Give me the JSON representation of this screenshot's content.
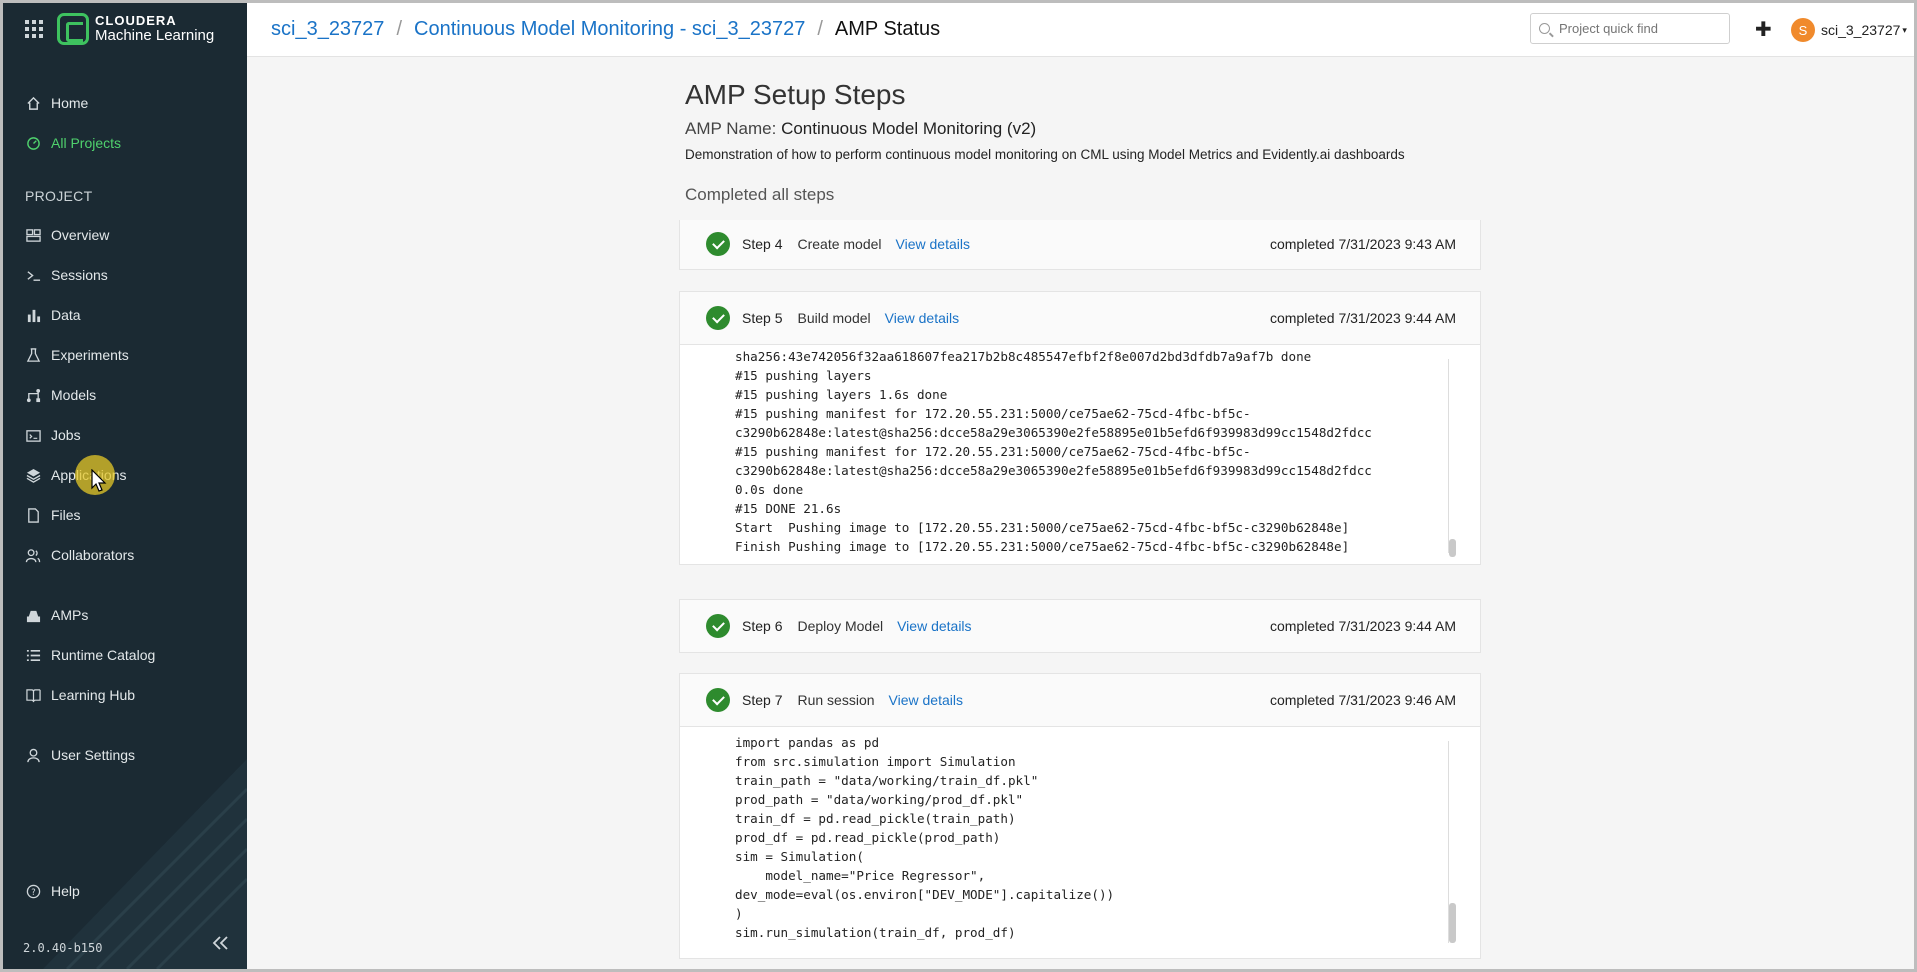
{
  "brand": {
    "line1": "CLOUDERA",
    "line2": "Machine Learning"
  },
  "sidebar": {
    "top_items": [
      {
        "label": "Home",
        "icon": "home-icon"
      },
      {
        "label": "All Projects",
        "icon": "projects-icon",
        "active": true
      }
    ],
    "section_label": "PROJECT",
    "project_items": [
      {
        "label": "Overview",
        "icon": "overview-icon"
      },
      {
        "label": "Sessions",
        "icon": "terminal-icon"
      },
      {
        "label": "Data",
        "icon": "bar-chart-icon"
      },
      {
        "label": "Experiments",
        "icon": "flask-icon"
      },
      {
        "label": "Models",
        "icon": "models-icon"
      },
      {
        "label": "Jobs",
        "icon": "jobs-icon"
      },
      {
        "label": "Applications",
        "icon": "layers-icon"
      },
      {
        "label": "Files",
        "icon": "file-icon"
      },
      {
        "label": "Collaborators",
        "icon": "users-icon"
      }
    ],
    "other_items": [
      {
        "label": "AMPs",
        "icon": "amps-icon"
      },
      {
        "label": "Runtime Catalog",
        "icon": "list-icon"
      },
      {
        "label": "Learning Hub",
        "icon": "book-icon"
      }
    ],
    "user_settings": "User Settings",
    "help": "Help",
    "version": "2.0.40-b150"
  },
  "header": {
    "breadcrumb": [
      "sci_3_23727",
      "Continuous Model Monitoring - sci_3_23727",
      "AMP Status"
    ],
    "search_placeholder": "Project quick find",
    "user_initial": "S",
    "user_name": "sci_3_23727"
  },
  "main": {
    "title": "AMP Setup Steps",
    "amp_name_label": "AMP Name:",
    "amp_name": "Continuous Model Monitoring (v2)",
    "description": "Demonstration of how to perform continuous model monitoring on CML using Model Metrics and Evidently.ai dashboards",
    "status": "Completed all steps",
    "details_label": "View details",
    "steps": [
      {
        "num": "Step 4",
        "title": "Create model",
        "time": "completed 7/31/2023 9:43 AM"
      },
      {
        "num": "Step 5",
        "title": "Build model",
        "time": "completed 7/31/2023 9:44 AM",
        "log": "sha256:43e742056f32aa618607fea217b2b8c485547efbf2f8e007d2bd3dfdb7a9af7b done\n#15 pushing layers\n#15 pushing layers 1.6s done\n#15 pushing manifest for 172.20.55.231:5000/ce75ae62-75cd-4fbc-bf5c-\nc3290b62848e:latest@sha256:dcce58a29e3065390e2fe58895e01b5efd6f939983d99cc1548d2fdcc\n#15 pushing manifest for 172.20.55.231:5000/ce75ae62-75cd-4fbc-bf5c-\nc3290b62848e:latest@sha256:dcce58a29e3065390e2fe58895e01b5efd6f939983d99cc1548d2fdcc\n0.0s done\n#15 DONE 21.6s\nStart  Pushing image to [172.20.55.231:5000/ce75ae62-75cd-4fbc-bf5c-c3290b62848e]\nFinish Pushing image to [172.20.55.231:5000/ce75ae62-75cd-4fbc-bf5c-c3290b62848e]"
      },
      {
        "num": "Step 6",
        "title": "Deploy Model",
        "time": "completed 7/31/2023 9:44 AM"
      },
      {
        "num": "Step 7",
        "title": "Run session",
        "time": "completed 7/31/2023 9:46 AM",
        "log": "import pandas as pd\nfrom src.simulation import Simulation\ntrain_path = \"data/working/train_df.pkl\"\nprod_path = \"data/working/prod_df.pkl\"\ntrain_df = pd.read_pickle(train_path)\nprod_df = pd.read_pickle(prod_path)\nsim = Simulation(\n    model_name=\"Price Regressor\",\ndev_mode=eval(os.environ[\"DEV_MODE\"].capitalize())\n)\nsim.run_simulation(train_df, prod_df)"
      }
    ]
  }
}
